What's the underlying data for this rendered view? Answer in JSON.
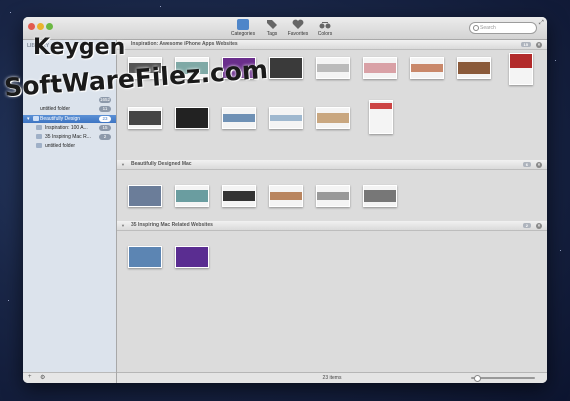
{
  "toolbar": {
    "items": [
      {
        "label": "Categories",
        "icon": "categories-icon",
        "active": true
      },
      {
        "label": "Tags",
        "icon": "tag-icon",
        "active": false
      },
      {
        "label": "Favorites",
        "icon": "heart-icon",
        "active": false
      },
      {
        "label": "Colors",
        "icon": "glasses-icon",
        "active": false
      }
    ],
    "search_placeholder": "Search"
  },
  "sidebar": {
    "heading": "LIBRARY",
    "items": [
      {
        "label": "",
        "count": "1652"
      },
      {
        "label": "untitled folder",
        "count": "11"
      },
      {
        "label": "Beautifully Design",
        "count": "23",
        "selected": true
      },
      {
        "label": "Inspiration: 100 A...",
        "count": "15"
      },
      {
        "label": "35 Inspiring Mac R...",
        "count": "2"
      },
      {
        "label": "untitled folder",
        "count": ""
      }
    ],
    "footer": {
      "add": "+",
      "settings": "⚙"
    }
  },
  "sections": [
    {
      "title": "Inspiration: Awesome iPhone Apps Websites",
      "count": "15"
    },
    {
      "title": "Beautifully Designed Mac",
      "count": "6"
    },
    {
      "title": "35 Inspiring Mac Related Websites",
      "count": "2"
    }
  ],
  "status": {
    "items": "23 items"
  },
  "watermark": {
    "line1": "Keygen",
    "line2": "SoftWareFilez.com"
  },
  "colors": {
    "accent": "#3d74c2",
    "sidebar": "#dce3ec"
  }
}
